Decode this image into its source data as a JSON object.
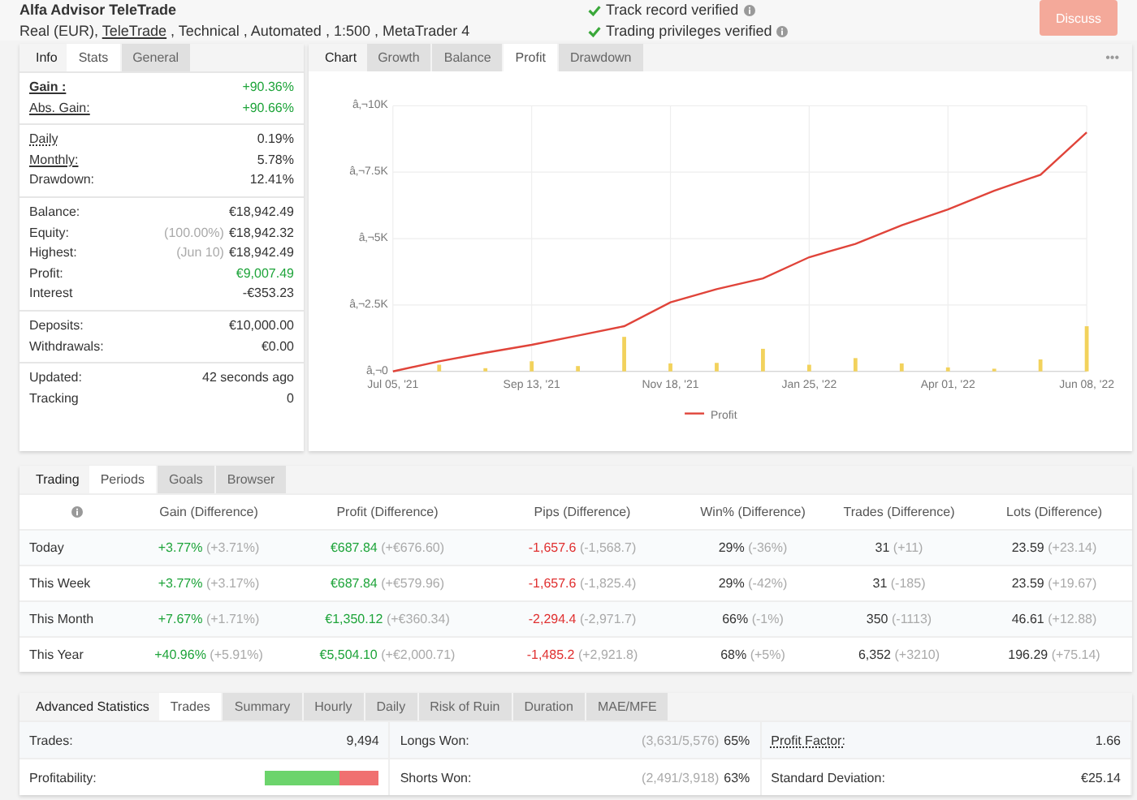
{
  "header": {
    "title": "Alfa Advisor TeleTrade",
    "details_prefix": "Real (EUR), ",
    "broker_link": "TeleTrade",
    "details_suffix": " , Technical , Automated , 1:500 , MetaTrader 4",
    "verifications": [
      {
        "label": "Track record verified"
      },
      {
        "label": "Trading privileges verified"
      }
    ],
    "action": "Discuss"
  },
  "stats": {
    "title": "Info",
    "tabs": [
      {
        "label": "Stats",
        "selected": true
      },
      {
        "label": "General",
        "selected": false
      }
    ],
    "groups": [
      [
        {
          "label": "Gain :",
          "value": "+90.36%",
          "color": "#1ea43a",
          "underline": true,
          "bold": true
        },
        {
          "label": "Abs. Gain:",
          "value": "+90.66%",
          "color": "#1ea43a",
          "underline": true
        }
      ],
      [
        {
          "label": "Daily",
          "value": "0.19%",
          "underline": true,
          "dotted": true
        },
        {
          "label": "Monthly:",
          "value": "5.78%",
          "underline": true
        },
        {
          "label": "Drawdown:",
          "value": "12.41%"
        }
      ],
      [
        {
          "label": "Balance:",
          "value": "€18,942.49"
        },
        {
          "label": "Equity:",
          "note": "(100.00%)",
          "value": "€18,942.32"
        },
        {
          "label": "Highest:",
          "note": "(Jun 10)",
          "value": "€18,942.49"
        },
        {
          "label": "Profit:",
          "value": "€9,007.49",
          "color": "#1ea43a"
        },
        {
          "label": "Interest",
          "value": "-€353.23"
        }
      ],
      [
        {
          "label": "Deposits:",
          "value": "€10,000.00"
        },
        {
          "label": "Withdrawals:",
          "value": "€0.00"
        }
      ],
      [
        {
          "label": "Updated:",
          "value": "42 seconds ago"
        },
        {
          "label": "Tracking",
          "value": "0"
        }
      ]
    ]
  },
  "chart_panel": {
    "title": "Chart",
    "tabs": [
      {
        "label": "Growth",
        "selected": false
      },
      {
        "label": "Balance",
        "selected": false
      },
      {
        "label": "Profit",
        "selected": true
      },
      {
        "label": "Drawdown",
        "selected": false
      }
    ],
    "menu": "•••",
    "chart_data": {
      "type": "line",
      "grid": true,
      "categories": [
        "Jul 05, '21",
        null,
        null,
        "Sep 13, '21",
        null,
        null,
        "Nov 18, '21",
        null,
        null,
        "Jan 25, '22",
        null,
        null,
        "Apr 01, '22",
        null,
        null,
        "Jun 08, '22"
      ],
      "yticks": [
        {
          "value": 0,
          "label": "â‚¬0"
        },
        {
          "value": 2500,
          "label": "â‚¬2.5K"
        },
        {
          "value": 5000,
          "label": "â‚¬5K"
        },
        {
          "value": 7500,
          "label": "â‚¬7.5K"
        },
        {
          "value": 10000,
          "label": "â‚¬10K"
        }
      ],
      "ylim": [
        0,
        10000
      ],
      "series": [
        {
          "name": "Profit",
          "color": "#e0443a",
          "values": [
            0,
            380,
            700,
            1000,
            1350,
            1700,
            2600,
            3100,
            3500,
            4300,
            4800,
            5500,
            6100,
            6800,
            7400,
            9000
          ]
        },
        {
          "color": "#f2d25c",
          "type": "bar",
          "values": [
            0,
            250,
            120,
            380,
            200,
            1300,
            300,
            320,
            850,
            250,
            500,
            300,
            150,
            100,
            450,
            1700
          ]
        }
      ]
    }
  },
  "periods": {
    "title": "Trading",
    "tabs": [
      {
        "label": "Periods",
        "selected": true
      },
      {
        "label": "Goals",
        "selected": false
      },
      {
        "label": "Browser",
        "selected": false
      }
    ],
    "columns": [
      "Gain (Difference)",
      "Profit (Difference)",
      "Pips (Difference)",
      "Win% (Difference)",
      "Trades (Difference)",
      "Lots (Difference)"
    ],
    "rows": [
      {
        "period": "Today",
        "cells": [
          {
            "value": "+3.77%",
            "diff": "(+3.71%)",
            "color": "#1ea43a"
          },
          {
            "value": "€687.84",
            "diff": "(+€676.60)",
            "color": "#1ea43a"
          },
          {
            "value": "-1,657.6",
            "diff": "(-1,568.7)",
            "color": "#e03030"
          },
          {
            "value": "29%",
            "diff": "(-36%)"
          },
          {
            "value": "31",
            "diff": "(+11)"
          },
          {
            "value": "23.59",
            "diff": "(+23.14)"
          }
        ]
      },
      {
        "period": "This Week",
        "cells": [
          {
            "value": "+3.77%",
            "diff": "(+3.17%)",
            "color": "#1ea43a"
          },
          {
            "value": "€687.84",
            "diff": "(+€579.96)",
            "color": "#1ea43a"
          },
          {
            "value": "-1,657.6",
            "diff": "(-1,825.4)",
            "color": "#e03030"
          },
          {
            "value": "29%",
            "diff": "(-42%)"
          },
          {
            "value": "31",
            "diff": "(-185)"
          },
          {
            "value": "23.59",
            "diff": "(+19.67)"
          }
        ]
      },
      {
        "period": "This Month",
        "cells": [
          {
            "value": "+7.67%",
            "diff": "(+1.71%)",
            "color": "#1ea43a"
          },
          {
            "value": "€1,350.12",
            "diff": "(+€360.34)",
            "color": "#1ea43a"
          },
          {
            "value": "-2,294.4",
            "diff": "(-2,971.7)",
            "color": "#e03030"
          },
          {
            "value": "66%",
            "diff": "(-1%)"
          },
          {
            "value": "350",
            "diff": "(-1113)"
          },
          {
            "value": "46.61",
            "diff": "(+12.88)"
          }
        ]
      },
      {
        "period": "This Year",
        "cells": [
          {
            "value": "+40.96%",
            "diff": "(+5.91%)",
            "color": "#1ea43a"
          },
          {
            "value": "€5,504.10",
            "diff": "(+€2,000.71)",
            "color": "#1ea43a"
          },
          {
            "value": "-1,485.2",
            "diff": "(+2,921.8)",
            "color": "#e03030"
          },
          {
            "value": "68%",
            "diff": "(+5%)"
          },
          {
            "value": "6,352",
            "diff": "(+3210)"
          },
          {
            "value": "196.29",
            "diff": "(+75.14)"
          }
        ]
      }
    ]
  },
  "advanced": {
    "title": "Advanced Statistics",
    "tabs": [
      {
        "label": "Trades",
        "selected": true
      },
      {
        "label": "Summary",
        "selected": false
      },
      {
        "label": "Hourly",
        "selected": false
      },
      {
        "label": "Daily",
        "selected": false
      },
      {
        "label": "Risk of Ruin",
        "selected": false
      },
      {
        "label": "Duration",
        "selected": false
      },
      {
        "label": "MAE/MFE",
        "selected": false
      }
    ],
    "rows": [
      [
        {
          "label": "Trades:",
          "kind": "text",
          "value": "9,494"
        },
        {
          "label": "Longs Won:",
          "kind": "text",
          "note": "(3,631/5,576)",
          "value": "65%"
        },
        {
          "label": "Profit Factor:",
          "kind": "text",
          "value": "1.66",
          "underline": true,
          "dotted": true
        }
      ],
      [
        {
          "label": "Profitability:",
          "kind": "bar",
          "level": 0.65
        },
        {
          "label": "Shorts Won:",
          "kind": "text",
          "note": "(2,491/3,918)",
          "value": "63%"
        },
        {
          "label": "Standard Deviation:",
          "kind": "text",
          "value": "€25.14"
        }
      ]
    ]
  }
}
